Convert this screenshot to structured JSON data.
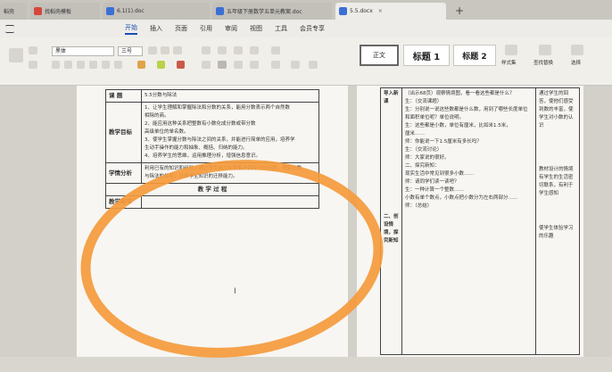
{
  "tabs": [
    {
      "label": "稻壳",
      "icon": "red"
    },
    {
      "label": "找稻壳模板",
      "icon": "red"
    },
    {
      "label": "6.1(1).doc",
      "icon": "blue"
    },
    {
      "label": "五年级下册数学五单元教案.doc",
      "icon": "blue"
    },
    {
      "label": "5.5.docx",
      "icon": "blue"
    }
  ],
  "menu": [
    "开始",
    "插入",
    "页面",
    "引用",
    "审阅",
    "视图",
    "工具",
    "会员专享"
  ],
  "font_name": "黑体",
  "font_size": "三号",
  "style_normal": "正文",
  "style_h1": "标题 1",
  "style_h2": "标题 2",
  "ribbon_labels": {
    "style_set": "样式集",
    "find_replace": "查找替换",
    "select": "选择"
  },
  "lesson_table": {
    "topic_label": "课 题",
    "topic_value": "5.5分数与除法",
    "goal_label": "教学目标",
    "goal_lines": [
      "1、让学生理解和掌握除法和分数的关系，能用分数表示两个自然数",
      "相除的商。",
      "2、能应用这种关系把整数有小数化成分数或带分数",
      "高级单位的单名数。",
      "3、使学生掌握分数与除法之间的关系，并能进行简单的应用，培养学",
      "生动手操作的能力和抽象、概括、归纳的能力。",
      "4、培养学生的思维，运用推理分析，增强信息意识。"
    ],
    "analysis_label": "学情分析",
    "analysis_lines": [
      "利用已有的知识和经验，通过学生自主探索解决实际中的问题，理解分数",
      "与除法的关系，培养学生知识的迁移能力。"
    ],
    "process_label": "教 学 过 程",
    "step_label": "教学环节"
  },
  "page2": {
    "left_col": [
      "导入新课",
      "二、创设情境，探究新知"
    ],
    "mid_lines": [
      "（出示68页）观察情境图，看一看这些都是什么？",
      "生：（交流课题）",
      "生：分别说一说这些数都是什么数，用到了哪些长度单位",
      "和面积单位呢？单位说明。",
      "生：这些都是小数，单位有厘米，比如米1.5米，",
      "厘米……",
      "师：你能说一下1.5厘米有多长吗？",
      "生：（交流讨论）",
      "师：大家说的很好。",
      "二、探究新知：",
      "现实生活中常见到很多小数……",
      "师：请同学们读一读吧？",
      "生：一种计算一个整数……",
      "小数有单个数点，小数点把小数分为左右两部分……",
      "师：（总结）"
    ],
    "right_lines": [
      "通过学生的回答，使他们感受到数的丰富，使学生对小数的认识",
      "教材设计的情境有学生的生活密切联系，有利于学生感知",
      "使学生体验学习的乐趣"
    ]
  }
}
